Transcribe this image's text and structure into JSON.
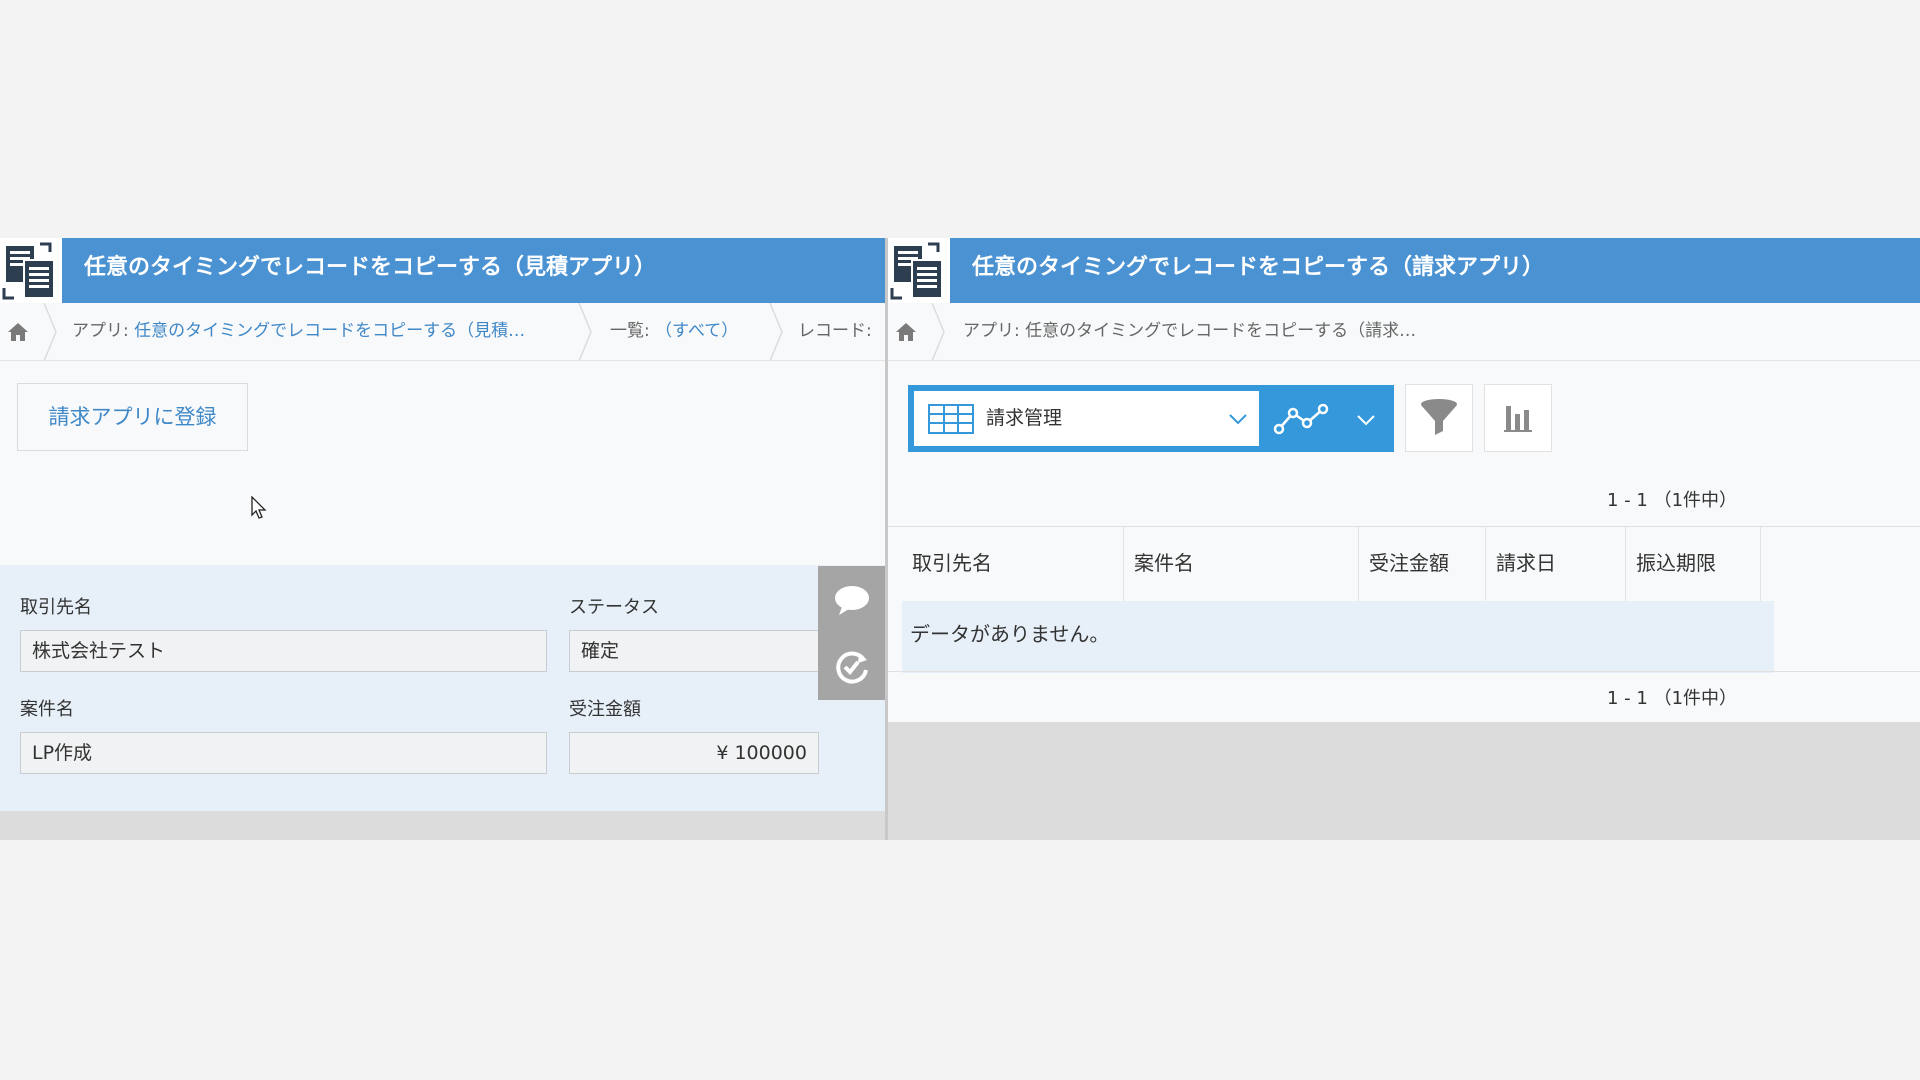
{
  "left": {
    "title": "任意のタイミングでレコードをコピーする（見積アプリ）",
    "breadcrumb": {
      "app_prefix": "アプリ: ",
      "app_name": "任意のタイミングでレコードをコピーする（見積…",
      "list_prefix": "一覧: ",
      "list_name": "（すべて）",
      "record_label": "レコード:"
    },
    "register_button_label": "請求アプリに登録",
    "fields": {
      "client_label": "取引先名",
      "client_value": "株式会社テスト",
      "status_label": "ステータス",
      "status_value": "確定",
      "project_label": "案件名",
      "project_value": "LP作成",
      "amount_label": "受注金額",
      "amount_value": "¥ 100000"
    },
    "side_tools": [
      "comment-icon",
      "history-icon"
    ]
  },
  "right": {
    "title": "任意のタイミングでレコードをコピーする（請求アプリ）",
    "breadcrumb": {
      "app_label": "アプリ: 任意のタイミングでレコードをコピーする（請求…"
    },
    "view_name": "請求管理",
    "pagination_top": "1 - 1 （1件中）",
    "pagination_bottom": "1 - 1 （1件中）",
    "columns": [
      "取引先名",
      "案件名",
      "受注金額",
      "請求日",
      "振込期限"
    ],
    "empty_message": "データがありません。"
  },
  "colors": {
    "header_blue": "#4b92d3",
    "view_bar_blue": "#3498db",
    "link_blue": "#3f88c8",
    "record_bg": "#e7f0f9"
  }
}
